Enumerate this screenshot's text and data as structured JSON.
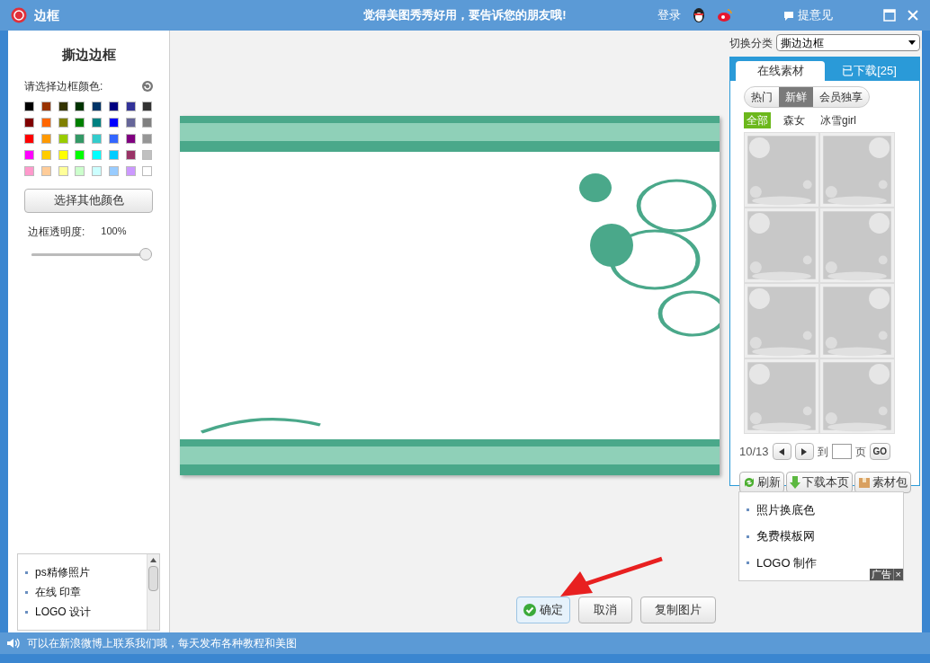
{
  "window": {
    "title": "边框",
    "slogan": "觉得美图秀秀好用，要告诉您的朋友哦!",
    "login": "登录",
    "feedback": "提意见"
  },
  "left": {
    "heading": "撕边边框",
    "color_label": "请选择边框颜色:",
    "swatches": [
      {
        "color": "#000000"
      },
      {
        "color": "#993300"
      },
      {
        "color": "#333300"
      },
      {
        "color": "#003300"
      },
      {
        "color": "#003366"
      },
      {
        "color": "#000080"
      },
      {
        "color": "#333399"
      },
      {
        "color": "#333333"
      },
      {
        "color": "#800000"
      },
      {
        "color": "#ff6600"
      },
      {
        "color": "#808000"
      },
      {
        "color": "#008000"
      },
      {
        "color": "#008080"
      },
      {
        "color": "#0000ff"
      },
      {
        "color": "#666699"
      },
      {
        "color": "#808080"
      },
      {
        "color": "#ff0000"
      },
      {
        "color": "#ff9900"
      },
      {
        "color": "#99cc00"
      },
      {
        "color": "#339966"
      },
      {
        "color": "#33cccc"
      },
      {
        "color": "#3366ff"
      },
      {
        "color": "#800080"
      },
      {
        "color": "#969696"
      },
      {
        "color": "#ff00ff"
      },
      {
        "color": "#ffcc00"
      },
      {
        "color": "#ffff00"
      },
      {
        "color": "#00ff00"
      },
      {
        "color": "#00ffff"
      },
      {
        "color": "#00ccff"
      },
      {
        "color": "#993366"
      },
      {
        "color": "#c0c0c0"
      },
      {
        "color": "#ff99cc"
      },
      {
        "color": "#ffcc99"
      },
      {
        "color": "#ffff99"
      },
      {
        "color": "#ccffcc"
      },
      {
        "color": "#ccffff"
      },
      {
        "color": "#99ccff"
      },
      {
        "color": "#cc99ff"
      },
      {
        "color": "#ffffff"
      }
    ],
    "other_color_button": "选择其他颜色",
    "opacity_label": "边框透明度:",
    "opacity_reading": "100%",
    "opacity": {
      "level": 1
    },
    "ad_links": [
      "ps精修照片",
      "在线 印章",
      "LOGO 设计"
    ]
  },
  "actions": [
    {
      "label": "确定",
      "kind": "primary"
    },
    {
      "label": "取消",
      "kind": "plain"
    },
    {
      "label": "复制图片",
      "kind": "plain"
    }
  ],
  "right": {
    "category_label": "切换分类",
    "category_value": "撕边边框",
    "tabs": [
      {
        "label": "在线素材",
        "selected": true
      },
      {
        "label": "已下载[25]",
        "selected": false
      }
    ],
    "filters": [
      {
        "label": "热门",
        "selected": false
      },
      {
        "label": "新鲜",
        "selected": true
      },
      {
        "label": "会员独享",
        "selected": false
      }
    ],
    "subcategories": [
      {
        "label": "全部",
        "selected": true
      },
      {
        "label": "森女",
        "selected": false
      },
      {
        "label": "冰雪girl",
        "selected": false
      }
    ],
    "page_indicator": "10/13",
    "goto_label": "到",
    "page_label": "页",
    "go_button": "GO",
    "tools": [
      {
        "label": "刷新",
        "kind": "refresh"
      },
      {
        "label": "下载本页",
        "kind": "download"
      },
      {
        "label": "素材包",
        "kind": "package"
      }
    ],
    "ad_links": [
      "照片换底色",
      "免费模板网",
      "LOGO 制作"
    ],
    "ad_badge": "广告",
    "ad_close": "×"
  },
  "status_bar": {
    "text": "可以在新浪微博上联系我们哦，每天发布各种教程和美图"
  }
}
